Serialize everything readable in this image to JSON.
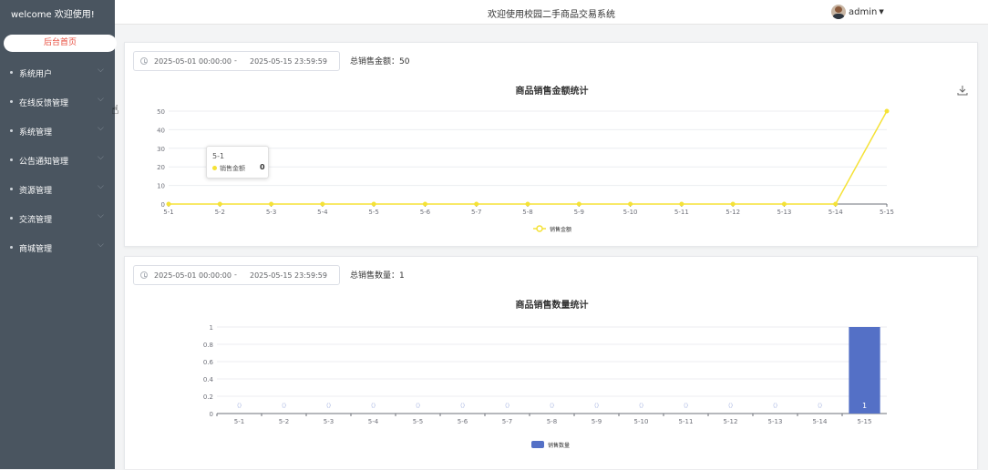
{
  "sidebar": {
    "title": "welcome 欢迎使用!",
    "home": "后台首页",
    "items": [
      {
        "label": "系统用户"
      },
      {
        "label": "在线反馈管理"
      },
      {
        "label": "系统管理"
      },
      {
        "label": "公告通知管理"
      },
      {
        "label": "资源管理"
      },
      {
        "label": "交流管理"
      },
      {
        "label": "商城管理"
      }
    ]
  },
  "header": {
    "title": "欢迎使用校园二手商品交易系统",
    "user": "admin"
  },
  "panel1": {
    "date_start": "2025-05-01 00:00:00",
    "date_sep": "-",
    "date_end": "2025-05-15 23:59:59",
    "total": "总销售金额：50",
    "tooltip": {
      "title": "5-1",
      "series": "销售金额",
      "value": "0"
    }
  },
  "panel2": {
    "date_start": "2025-05-01 00:00:00",
    "date_sep": "-",
    "date_end": "2025-05-15 23:59:59",
    "total": "总销售数量：1"
  },
  "chart_data": [
    {
      "type": "line",
      "title": "商品销售金额统计",
      "categories": [
        "5-1",
        "5-2",
        "5-3",
        "5-4",
        "5-5",
        "5-6",
        "5-7",
        "5-8",
        "5-9",
        "5-10",
        "5-11",
        "5-12",
        "5-13",
        "5-14",
        "5-15"
      ],
      "series": [
        {
          "name": "销售金额",
          "values": [
            0,
            0,
            0,
            0,
            0,
            0,
            0,
            0,
            0,
            0,
            0,
            0,
            0,
            0,
            50
          ],
          "color": "#f5e237"
        }
      ],
      "ylim": [
        0,
        50
      ],
      "yticks": [
        0,
        10,
        20,
        30,
        40,
        50
      ],
      "legend": "bottom-center",
      "grid": true
    },
    {
      "type": "bar",
      "title": "商品销售数量统计",
      "categories": [
        "5-1",
        "5-2",
        "5-3",
        "5-4",
        "5-5",
        "5-6",
        "5-7",
        "5-8",
        "5-9",
        "5-10",
        "5-11",
        "5-12",
        "5-13",
        "5-14",
        "5-15"
      ],
      "series": [
        {
          "name": "销售数量",
          "values": [
            0,
            0,
            0,
            0,
            0,
            0,
            0,
            0,
            0,
            0,
            0,
            0,
            0,
            0,
            1
          ],
          "color": "#5470c6"
        }
      ],
      "ylim": [
        0,
        1
      ],
      "yticks": [
        "0",
        "0.2",
        "0.4",
        "0.6",
        "0.8",
        "1"
      ],
      "legend": "bottom-center",
      "grid": true
    }
  ]
}
